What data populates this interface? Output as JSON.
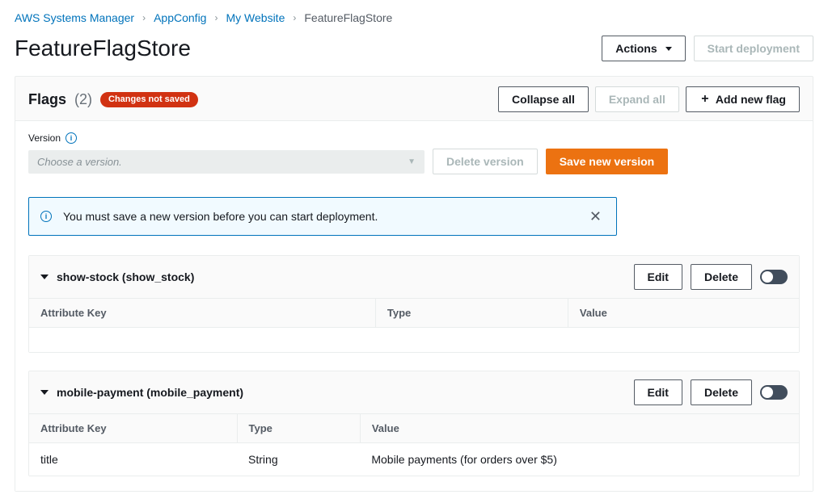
{
  "breadcrumb": {
    "items": [
      "AWS Systems Manager",
      "AppConfig",
      "My Website"
    ],
    "current": "FeatureFlagStore"
  },
  "page": {
    "title": "FeatureFlagStore",
    "actions_label": "Actions",
    "start_deployment_label": "Start deployment"
  },
  "flags_panel": {
    "title": "Flags",
    "count": "(2)",
    "badge": "Changes not saved",
    "collapse_label": "Collapse all",
    "expand_label": "Expand all",
    "add_label": "Add new flag"
  },
  "version": {
    "label": "Version",
    "placeholder": "Choose a version.",
    "delete_label": "Delete version",
    "save_label": "Save new version"
  },
  "alert": {
    "message": "You must save a new version before you can start deployment."
  },
  "table": {
    "col_key": "Attribute Key",
    "col_type": "Type",
    "col_value": "Value"
  },
  "buttons": {
    "edit": "Edit",
    "delete": "Delete"
  },
  "flags": [
    {
      "title": "show-stock (show_stock)",
      "rows": []
    },
    {
      "title": "mobile-payment (mobile_payment)",
      "rows": [
        {
          "key": "title",
          "type": "String",
          "value": "Mobile payments (for orders over $5)"
        }
      ]
    }
  ]
}
